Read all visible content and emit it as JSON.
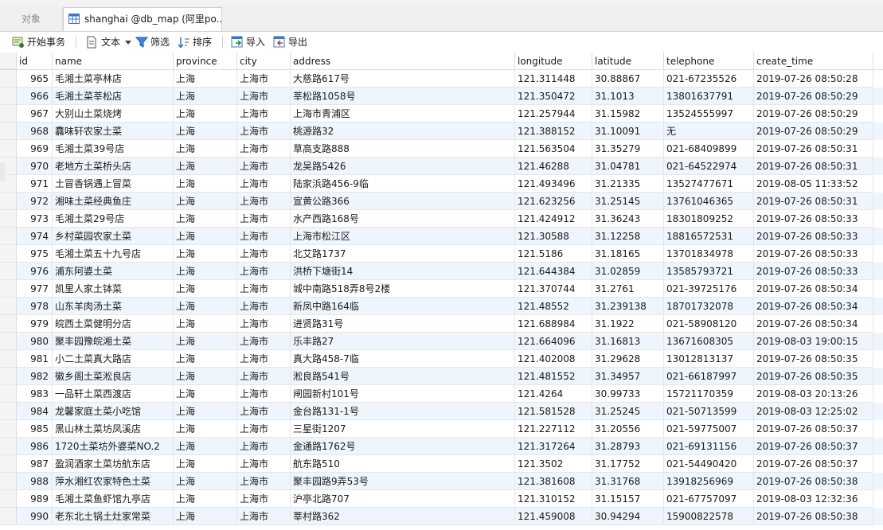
{
  "tabs": {
    "objects_label": "对象",
    "active_label": "shanghai @db_map (阿里po..."
  },
  "toolbar": {
    "begin_transaction": "开始事务",
    "text": "文本",
    "filter": "筛选",
    "sort": "排序",
    "import": "导入",
    "export": "导出"
  },
  "columns": [
    "id",
    "name",
    "province",
    "city",
    "address",
    "longitude",
    "latitude",
    "telephone",
    "create_time"
  ],
  "rows": [
    [
      "965",
      "毛湘土菜亭林店",
      "上海",
      "上海市",
      "大慈路617号",
      "121.311448",
      "30.88867",
      "021-67235526",
      "2019-07-26 08:50:28"
    ],
    [
      "966",
      "毛湘土菜莘松店",
      "上海",
      "上海市",
      "莘松路1058号",
      "121.350472",
      "31.1013",
      "13801637791",
      "2019-07-26 08:50:29"
    ],
    [
      "967",
      "大别山土菜烧烤",
      "上海",
      "上海市",
      "上海市青浦区",
      "121.257944",
      "31.15982",
      "13524555997",
      "2019-07-26 08:50:29"
    ],
    [
      "968",
      "馫味轩农家土菜",
      "上海",
      "上海市",
      "桃源路32",
      "121.388152",
      "31.10091",
      "无",
      "2019-07-26 08:50:29"
    ],
    [
      "969",
      "毛湘土菜39号店",
      "上海",
      "上海市",
      "草高支路888",
      "121.563504",
      "31.35279",
      "021-68409899",
      "2019-07-26 08:50:31"
    ],
    [
      "970",
      "老地方土菜桥头店",
      "上海",
      "上海市",
      "龙吴路5426",
      "121.46288",
      "31.04781",
      "021-64522974",
      "2019-07-26 08:50:31"
    ],
    [
      "971",
      "土冒香锅遇上冒菜",
      "上海",
      "上海市",
      "陆家浜路456-9临",
      "121.493496",
      "31.21335",
      "13527477671",
      "2019-08-05 11:33:52"
    ],
    [
      "972",
      "湘味土菜经典鱼庄",
      "上海",
      "上海市",
      "宣黄公路366",
      "121.623256",
      "31.25145",
      "13761046365",
      "2019-07-26 08:50:31"
    ],
    [
      "973",
      "毛湘土菜29号店",
      "上海",
      "上海市",
      "水产西路168号",
      "121.424912",
      "31.36243",
      "18301809252",
      "2019-07-26 08:50:33"
    ],
    [
      "974",
      "乡村菜园农家土菜",
      "上海",
      "上海市",
      "上海市松江区",
      "121.30588",
      "31.12258",
      "18816572531",
      "2019-07-26 08:50:33"
    ],
    [
      "975",
      "毛湘土菜五十九号店",
      "上海",
      "上海市",
      "北艾路1737",
      "121.5186",
      "31.18165",
      "13701834978",
      "2019-07-26 08:50:33"
    ],
    [
      "976",
      "浦东阿婆土菜",
      "上海",
      "上海市",
      "洪桥下塘街14",
      "121.644384",
      "31.02859",
      "13585793721",
      "2019-07-26 08:50:33"
    ],
    [
      "977",
      "凯里人家土钵菜",
      "上海",
      "上海市",
      "城中南路518弄8号2楼",
      "121.370744",
      "31.2761",
      "021-39725176",
      "2019-07-26 08:50:34"
    ],
    [
      "978",
      "山东羊肉汤土菜",
      "上海",
      "上海市",
      "新凤中路164临",
      "121.48552",
      "31.239138",
      "18701732078",
      "2019-07-26 08:50:34"
    ],
    [
      "979",
      "皖西土菜健明分店",
      "上海",
      "上海市",
      "进贤路31号",
      "121.688984",
      "31.1922",
      "021-58908120",
      "2019-07-26 08:50:34"
    ],
    [
      "980",
      "聚丰园豫皖湘土菜",
      "上海",
      "上海市",
      "乐丰路27",
      "121.664096",
      "31.16813",
      "13671608305",
      "2019-08-03 19:00:15"
    ],
    [
      "981",
      "小二土菜真大路店",
      "上海",
      "上海市",
      "真大路458-7临",
      "121.402008",
      "31.29628",
      "13012813137",
      "2019-07-26 08:50:35"
    ],
    [
      "982",
      "徽乡阁土菜淞良店",
      "上海",
      "上海市",
      "淞良路541号",
      "121.481552",
      "31.34957",
      "021-66187997",
      "2019-07-26 08:50:35"
    ],
    [
      "983",
      "一品轩土菜西渡店",
      "上海",
      "上海市",
      "闸园新村101号",
      "121.4264",
      "30.99733",
      "15721170359",
      "2019-08-03 20:13:26"
    ],
    [
      "984",
      "龙馨家庭土菜小吃馆",
      "上海",
      "上海市",
      "金台路131-1号",
      "121.581528",
      "31.25245",
      "021-50713599",
      "2019-08-03 12:25:02"
    ],
    [
      "985",
      "黑山林土菜坊凤溪店",
      "上海",
      "上海市",
      "三星街1207",
      "121.227112",
      "31.20556",
      "021-59775007",
      "2019-07-26 08:50:37"
    ],
    [
      "986",
      "1720土菜坊外婆菜NO.2",
      "上海",
      "上海市",
      "金通路1762号",
      "121.317264",
      "31.28793",
      "021-69131156",
      "2019-07-26 08:50:37"
    ],
    [
      "987",
      "盈润酒家土菜坊航东店",
      "上海",
      "上海市",
      "航东路510",
      "121.3502",
      "31.17752",
      "021-54490420",
      "2019-07-26 08:50:37"
    ],
    [
      "988",
      "萍水湘红农家特色土菜",
      "上海",
      "上海市",
      "聚丰园路9弄53号",
      "121.381608",
      "31.31768",
      "13918256969",
      "2019-07-26 08:50:38"
    ],
    [
      "989",
      "毛湘土菜鱼虾馆九亭店",
      "上海",
      "上海市",
      "沪亭北路707",
      "121.310152",
      "31.15157",
      "021-67757097",
      "2019-08-03 12:32:36"
    ],
    [
      "990",
      "老东北土锅土灶家常菜",
      "上海",
      "上海市",
      "莘村路362",
      "121.459008",
      "30.94294",
      "15900822578",
      "2019-07-26 08:50:38"
    ]
  ]
}
